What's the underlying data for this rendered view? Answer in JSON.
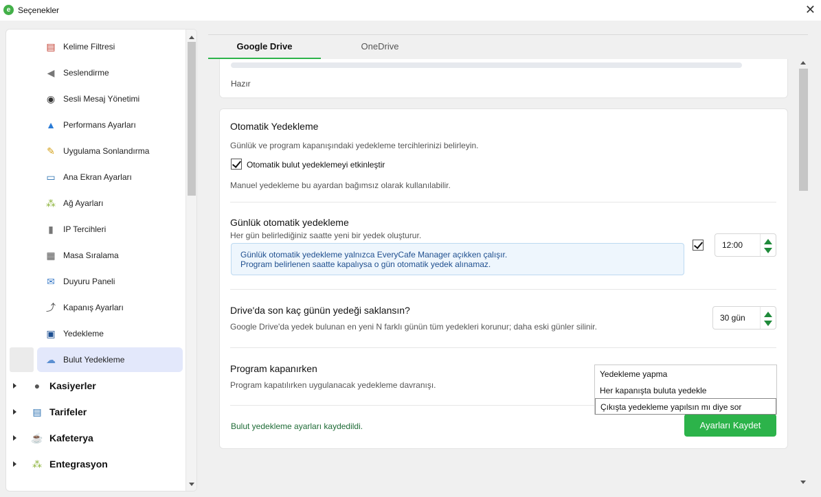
{
  "window": {
    "logo_letter": "e",
    "title": "Seçenekler",
    "close_symbol": "✕"
  },
  "sidebar": {
    "sub_items": [
      {
        "label": "Kelime Filtresi",
        "icon": "word-filter-icon",
        "glyph": "▤"
      },
      {
        "label": "Seslendirme",
        "icon": "speaker-icon",
        "glyph": "🔊"
      },
      {
        "label": "Sesli Mesaj Yönetimi",
        "icon": "voice-message-icon",
        "glyph": "🎧"
      },
      {
        "label": "Performans Ayarları",
        "icon": "performance-icon",
        "glyph": "📈"
      },
      {
        "label": "Uygulama Sonlandırma",
        "icon": "broom-icon",
        "glyph": "🧹"
      },
      {
        "label": "Ana Ekran Ayarları",
        "icon": "monitor-icon",
        "glyph": "🖥"
      },
      {
        "label": "Ağ Ayarları",
        "icon": "network-icon",
        "glyph": "⁂"
      },
      {
        "label": "IP Tercihleri",
        "icon": "ip-icon",
        "glyph": "▮"
      },
      {
        "label": "Masa Sıralama",
        "icon": "grid-icon",
        "glyph": "▦"
      },
      {
        "label": "Duyuru Paneli",
        "icon": "envelope-icon",
        "glyph": "✉"
      },
      {
        "label": "Kapanış Ayarları",
        "icon": "shutdown-icon",
        "glyph": "⤴"
      },
      {
        "label": "Yedekleme",
        "icon": "floppy-disk-icon",
        "glyph": "💾"
      },
      {
        "label": "Bulut Yedekleme",
        "icon": "cloud-icon",
        "glyph": "☁"
      }
    ],
    "groups": [
      {
        "label": "Kasiyerler",
        "icon": "cashier-icon",
        "glyph": "👤"
      },
      {
        "label": "Tarifeler",
        "icon": "tariff-icon",
        "glyph": "📋"
      },
      {
        "label": "Kafeterya",
        "icon": "coffee-icon",
        "glyph": "☕"
      },
      {
        "label": "Entegrasyon",
        "icon": "integration-icon",
        "glyph": "⁂"
      }
    ]
  },
  "tabs": [
    {
      "label": "Google Drive",
      "active": true
    },
    {
      "label": "OneDrive",
      "active": false
    }
  ],
  "status": {
    "progress": 0,
    "text": "Hazır"
  },
  "auto_backup": {
    "title": "Otomatik Yedekleme",
    "description": "Günlük ve program kapanışındaki yedekleme tercihlerinizi belirleyin.",
    "checkbox_label": "Otomatik bulut yedeklemeyi etkinleştir",
    "checked": true,
    "note": "Manuel yedekleme bu ayardan bağımsız olarak kullanılabilir."
  },
  "daily_backup": {
    "title": "Günlük otomatik yedekleme",
    "description": "Her gün belirlediğiniz saatte yeni bir yedek oluşturur.",
    "info_line1": "Günlük otomatik yedekleme yalnızca EveryCafe Manager açıkken çalışır.",
    "info_line2": "Program belirlenen saatte kapalıysa o gün otomatik yedek alınamaz.",
    "checked": true,
    "time": "12:00"
  },
  "retention": {
    "title": "Drive'da son kaç günün yedeği saklansın?",
    "description": "Google Drive'da yedek bulunan en yeni N farklı günün tüm yedekleri korunur; daha eski günler silinir.",
    "days": "30 gün"
  },
  "on_close": {
    "title": "Program kapanırken",
    "description": "Program kapatılırken uygulanacak yedekleme davranışı.",
    "options": [
      "Yedekleme yapma",
      "Her kapanışta buluta yedekle",
      "Çıkışta yedekleme yapılsın mı diye sor"
    ],
    "selected_index": 2
  },
  "footer": {
    "saved_message": "Bulut yedekleme ayarları kaydedildi.",
    "save_button": "Ayarları Kaydet"
  },
  "colors": {
    "accent": "#2cb34a",
    "spinner_arrow": "#1f8a3a",
    "info_bg": "#eef6fd",
    "selected_sidebar": "#e3e8fb"
  }
}
